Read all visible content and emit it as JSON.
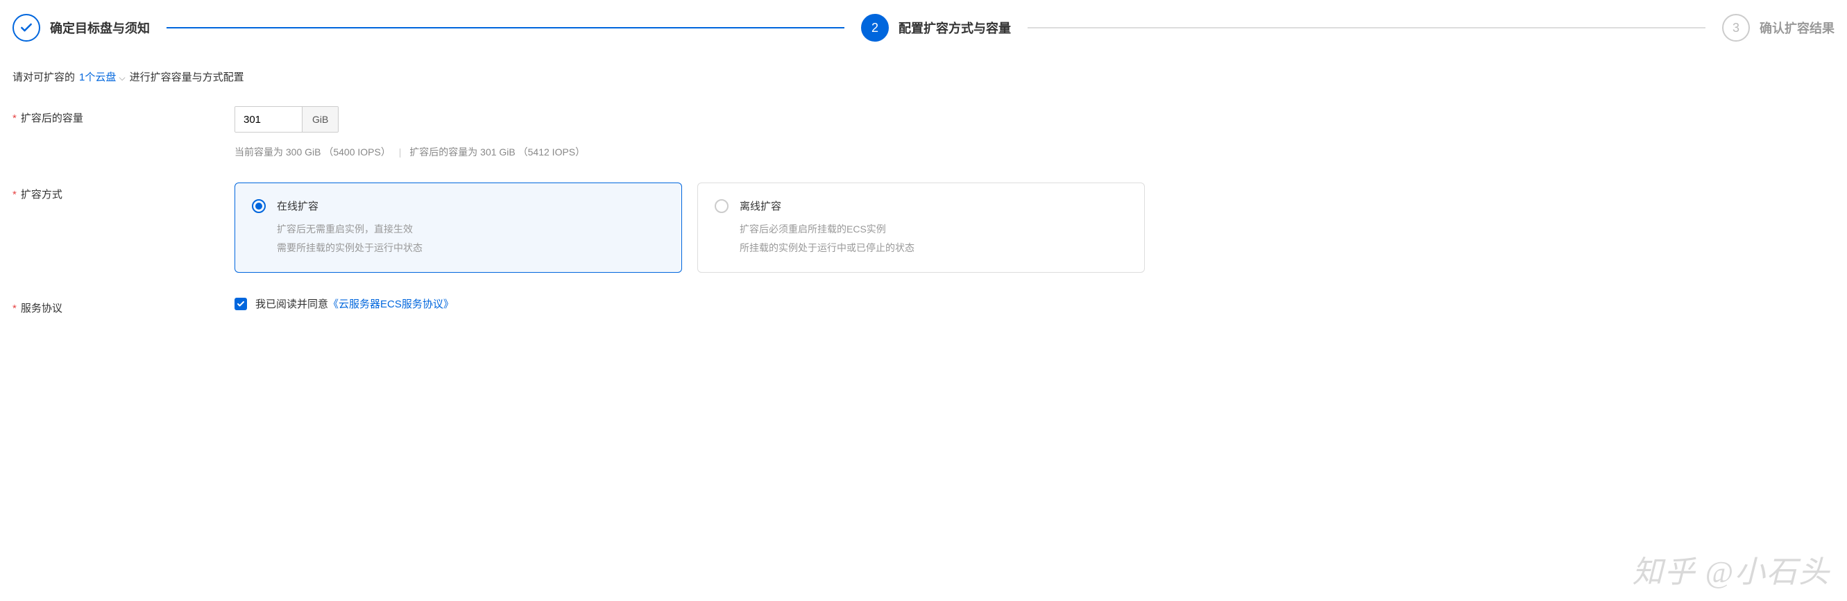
{
  "stepper": {
    "step1_label": "确定目标盘与须知",
    "step2_number": "2",
    "step2_label": "配置扩容方式与容量",
    "step3_number": "3",
    "step3_label": "确认扩容结果"
  },
  "instruction": {
    "prefix": "请对可扩容的",
    "disk_link": "1个云盘",
    "suffix": "进行扩容容量与方式配置"
  },
  "capacity": {
    "label": "扩容后的容量",
    "value": "301",
    "unit": "GiB",
    "helper_current": "当前容量为 300 GiB  （5400 IOPS）",
    "helper_after": "扩容后的容量为 301 GiB  （5412 IOPS）"
  },
  "method": {
    "label": "扩容方式",
    "option_online": {
      "title": "在线扩容",
      "desc1": "扩容后无需重启实例，直接生效",
      "desc2": "需要所挂载的实例处于运行中状态"
    },
    "option_offline": {
      "title": "离线扩容",
      "desc1": "扩容后必须重启所挂载的ECS实例",
      "desc2": "所挂载的实例处于运行中或已停止的状态"
    }
  },
  "agreement": {
    "label": "服务协议",
    "text": "我已阅读并同意",
    "link": "《云服务器ECS服务协议》"
  },
  "watermark": "知乎 @小石头"
}
